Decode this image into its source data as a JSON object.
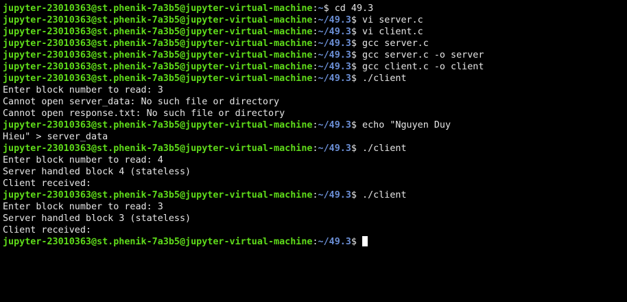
{
  "colors": {
    "background": "#000000",
    "user_host": "#5fdc1a",
    "path": "#6b8fd6",
    "text": "#e6e6e6",
    "cursor": "#ffffff"
  },
  "prompt": {
    "user_host": "jupyter-23010363@st.phenik-7a3b5@jupyter-virtual-machine",
    "home_path": "~",
    "dir_path": "~/49.3",
    "symbol": "$ "
  },
  "lines": [
    {
      "type": "prompt",
      "path": "~",
      "cmd": "cd 49.3"
    },
    {
      "type": "prompt",
      "path": "~/49.3",
      "cmd": "vi server.c"
    },
    {
      "type": "prompt",
      "path": "~/49.3",
      "cmd": "vi client.c"
    },
    {
      "type": "prompt",
      "path": "~/49.3",
      "cmd": "gcc server.c"
    },
    {
      "type": "prompt",
      "path": "~/49.3",
      "cmd": "gcc server.c -o server"
    },
    {
      "type": "prompt",
      "path": "~/49.3",
      "cmd": "gcc client.c -o client"
    },
    {
      "type": "prompt",
      "path": "~/49.3",
      "cmd": "./client"
    },
    {
      "type": "output",
      "text": "Enter block number to read: 3"
    },
    {
      "type": "output",
      "text": "Cannot open server_data: No such file or directory"
    },
    {
      "type": "output",
      "text": "Cannot open response.txt: No such file or directory"
    },
    {
      "type": "prompt",
      "path": "~/49.3",
      "cmd": "echo \"Nguyen Duy"
    },
    {
      "type": "output",
      "text": "Hieu\" > server_data"
    },
    {
      "type": "prompt",
      "path": "~/49.3",
      "cmd": "./client"
    },
    {
      "type": "output",
      "text": "Enter block number to read: 4"
    },
    {
      "type": "output",
      "text": "Server handled block 4 (stateless)"
    },
    {
      "type": "output",
      "text": "Client received:"
    },
    {
      "type": "prompt",
      "path": "~/49.3",
      "cmd": "./client"
    },
    {
      "type": "output",
      "text": "Enter block number to read: 3"
    },
    {
      "type": "output",
      "text": "Server handled block 3 (stateless)"
    },
    {
      "type": "output",
      "text": "Client received:"
    },
    {
      "type": "prompt",
      "path": "~/49.3",
      "cmd": "",
      "cursor": true
    }
  ]
}
